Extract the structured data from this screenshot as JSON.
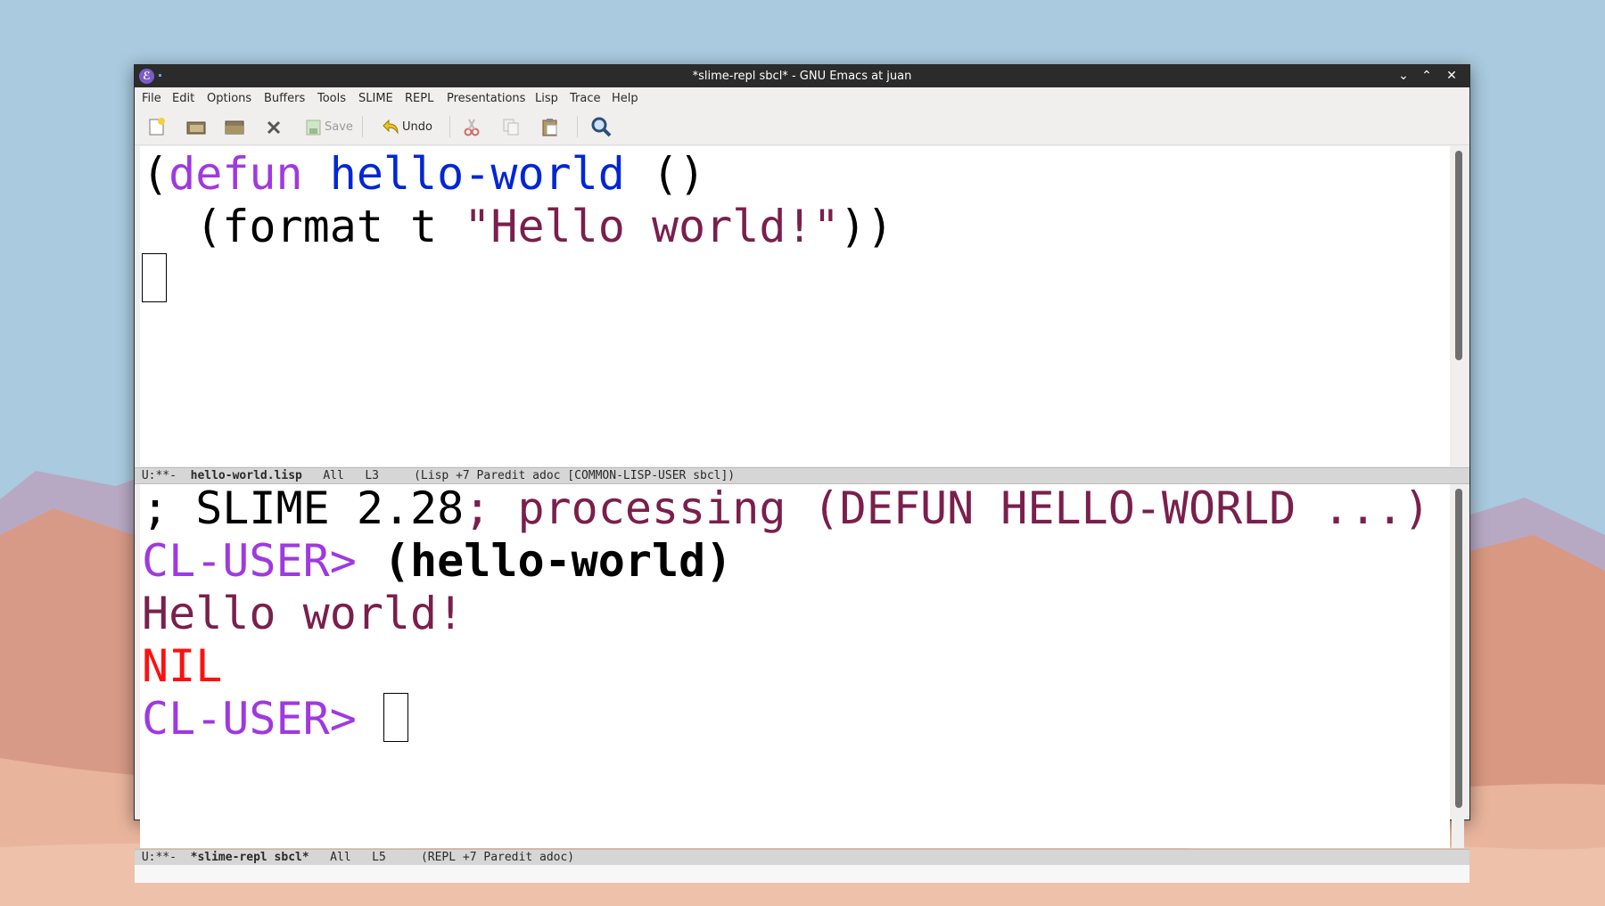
{
  "window": {
    "title": "*slime-repl sbcl* - GNU Emacs at juan",
    "icon": "emacs-icon"
  },
  "menu": [
    "File",
    "Edit",
    "Options",
    "Buffers",
    "Tools",
    "SLIME",
    "REPL",
    "Presentations",
    "Lisp",
    "Trace",
    "Help"
  ],
  "toolbar": {
    "save_label": "Save",
    "undo_label": "Undo"
  },
  "editor": {
    "line1": {
      "open": "(",
      "kw": "defun",
      "space1": " ",
      "fn": "hello-world",
      "rest": " ()"
    },
    "line2": {
      "indent": "  (format t ",
      "str": "\"Hello world!\"",
      "close": "))"
    }
  },
  "modeline_top": {
    "status": "U:**-",
    "buffer": "hello-world.lisp",
    "position": "All",
    "line": "L3",
    "modes": "(Lisp +7 Paredit adoc [COMMON-LISP-USER sbcl])"
  },
  "repl": {
    "banner_a": "; SLIME 2.28",
    "banner_b": "; processing (DEFUN HELLO-WORLD ...)",
    "prompt": "CL-USER>",
    "input": "(hello-world)",
    "output": "Hello world!",
    "result": "NIL"
  },
  "modeline_bottom": {
    "status": "U:**-",
    "buffer": "*slime-repl sbcl*",
    "position": "All",
    "line": "L5",
    "modes": "(REPL +7 Paredit adoc)"
  },
  "colors": {
    "keyword": "#9f39e0",
    "function_name": "#0026d6",
    "string": "#7a1f4c",
    "nil": "#ff1010"
  }
}
